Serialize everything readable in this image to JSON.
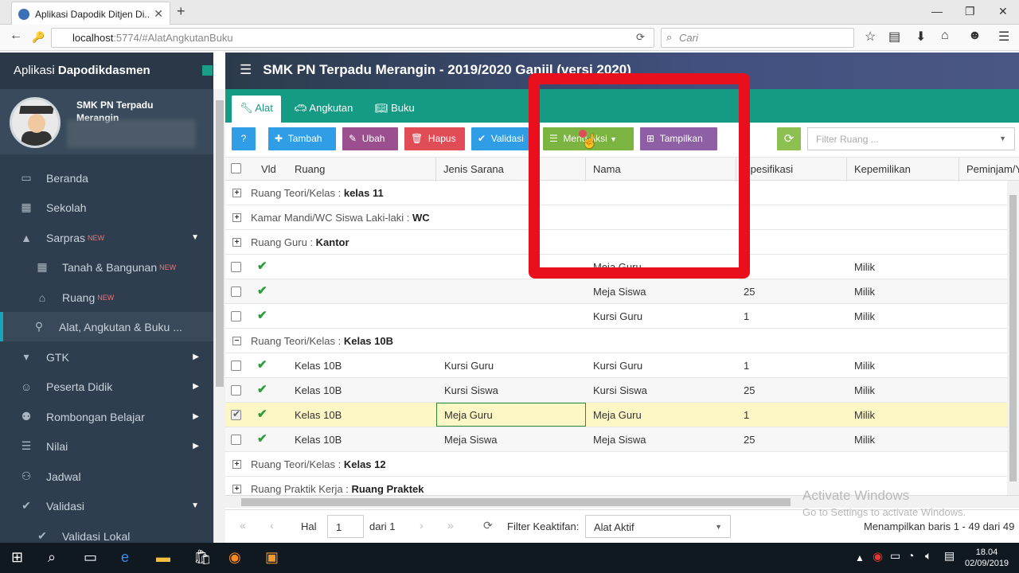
{
  "browser": {
    "tab_title": "Aplikasi Dapodik Ditjen Di...",
    "url_host": "localhost",
    "url_rest": ":5774/#AlatAngkutanBuku",
    "search_placeholder": "Cari"
  },
  "sidebar": {
    "brand_prefix": "Aplikasi",
    "brand_name": "Dapodikdasmen",
    "school_name": "SMK PN Terpadu Merangin",
    "items": [
      {
        "label": "Beranda",
        "icon": "monitor-icon"
      },
      {
        "label": "Sekolah",
        "icon": "building-icon"
      },
      {
        "label": "Sarpras",
        "icon": "road-icon",
        "badge": "NEW"
      },
      {
        "label": "Tanah & Bangunan",
        "icon": "building-icon",
        "badge": "NEW"
      },
      {
        "label": "Ruang",
        "icon": "home-icon",
        "badge": "NEW"
      },
      {
        "label": "Alat, Angkutan & Buku ...",
        "icon": "motorcycle-icon"
      },
      {
        "label": "GTK",
        "icon": "graduation-cap-icon"
      },
      {
        "label": "Peserta Didik",
        "icon": "smile-icon"
      },
      {
        "label": "Rombongan Belajar",
        "icon": "users-icon"
      },
      {
        "label": "Nilai",
        "icon": "list-icon"
      },
      {
        "label": "Jadwal",
        "icon": "group-icon"
      },
      {
        "label": "Validasi",
        "icon": "check-icon"
      },
      {
        "label": "Validasi Lokal",
        "icon": "check-icon"
      }
    ]
  },
  "header": {
    "title": "SMK PN Terpadu Merangin - 2019/2020 Ganjil (versi 2020)"
  },
  "tabs": [
    {
      "label": "Alat"
    },
    {
      "label": "Angkutan"
    },
    {
      "label": "Buku"
    }
  ],
  "toolbar": {
    "help": "?",
    "tambah": "Tambah",
    "ubah": "Ubah",
    "hapus": "Hapus",
    "validasi": "Validasi",
    "menu_aksi": "Menu Aksi",
    "tampilkan": "Tampilkan",
    "filter_placeholder": "Filter Ruang ...",
    "colors": {
      "help": "#2f9ee6",
      "tambah": "#2f9ee6",
      "ubah": "#9b4f8e",
      "hapus": "#e14d57",
      "validasi": "#2f9ee6",
      "menu_aksi": "#7cb442",
      "tampilkan": "#8e5fa5",
      "refresh": "#8cc152"
    }
  },
  "grid": {
    "columns": [
      "Vld",
      "Ruang",
      "Jenis Sarana",
      "Nama",
      "Spesifikasi",
      "Kepemilikan",
      "Peminjam/Y"
    ],
    "rows": [
      {
        "type": "group",
        "expanded": false,
        "prefix": "Ruang Teori/Kelas : ",
        "name": "kelas 11"
      },
      {
        "type": "group",
        "expanded": false,
        "prefix": "Kamar Mandi/WC Siswa Laki-laki : ",
        "name": "WC"
      },
      {
        "type": "group",
        "expanded": false,
        "prefix": "Ruang Guru : ",
        "name": "Kantor"
      },
      {
        "type": "data",
        "ruang": "",
        "jenis": "",
        "nama": "Meja Guru",
        "spes": "",
        "milik": "Milik"
      },
      {
        "type": "data",
        "ruang": "",
        "jenis": "",
        "nama": "Meja Siswa",
        "spes": "25",
        "milik": "Milik"
      },
      {
        "type": "data",
        "ruang": "",
        "jenis": "",
        "nama": "Kursi Guru",
        "spes": "1",
        "milik": "Milik"
      },
      {
        "type": "group",
        "expanded": true,
        "prefix": "Ruang Teori/Kelas : ",
        "name": "Kelas 10B"
      },
      {
        "type": "data",
        "ruang": "Kelas 10B",
        "jenis": "Kursi Guru",
        "nama": "Kursi Guru",
        "spes": "1",
        "milik": "Milik"
      },
      {
        "type": "data",
        "ruang": "Kelas 10B",
        "jenis": "Kursi Siswa",
        "nama": "Kursi Siswa",
        "spes": "25",
        "milik": "Milik"
      },
      {
        "type": "data",
        "selected": true,
        "ruang": "Kelas 10B",
        "jenis": "Meja Guru",
        "nama": "Meja Guru",
        "spes": "1",
        "milik": "Milik"
      },
      {
        "type": "data",
        "ruang": "Kelas 10B",
        "jenis": "Meja Siswa",
        "nama": "Meja Siswa",
        "spes": "25",
        "milik": "Milik"
      },
      {
        "type": "group",
        "expanded": false,
        "prefix": "Ruang Teori/Kelas : ",
        "name": "Kelas 12"
      },
      {
        "type": "group",
        "expanded": false,
        "prefix": "Ruang Praktik Kerja : ",
        "name": "Ruang Praktek"
      }
    ]
  },
  "pager": {
    "hal_label": "Hal",
    "page": "1",
    "of_label": "dari 1",
    "filter_label": "Filter Keaktifan:",
    "filter_value": "Alat Aktif",
    "summary": "Menampilkan baris 1 - 49 dari 49"
  },
  "watermark": {
    "line1": "Activate Windows",
    "line2": "Go to Settings to activate Windows."
  },
  "taskbar": {
    "time": "18.04",
    "date": "02/09/2019"
  },
  "accent_color": "#159a84",
  "highlight_color": "#ea0f1c"
}
